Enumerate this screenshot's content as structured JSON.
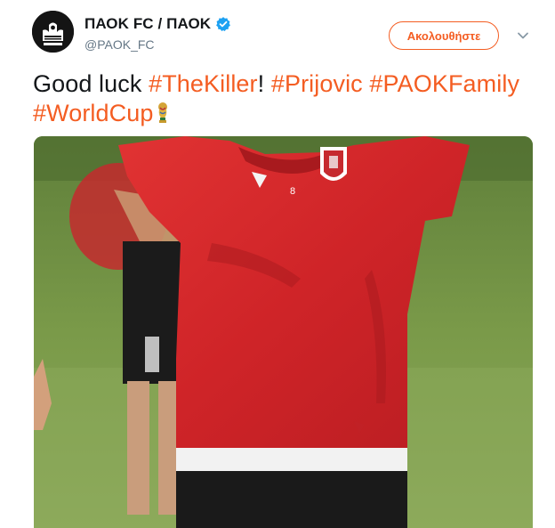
{
  "header": {
    "display_name": "ΠΑΟΚ FC / ΠΑΟΚ",
    "handle": "@PAOK_FC",
    "follow_label": "Ακολουθήστε",
    "avatar_icon": "paok-eagle-logo-icon",
    "verified_icon": "verified-badge-icon",
    "caret_icon": "chevron-down-icon"
  },
  "tweet": {
    "text_plain": "Good luck",
    "tag_1": "#TheKiller",
    "sep_1": "!",
    "tag_2": "#Prijovic",
    "tag_3": "#PAOKFamily",
    "tag_4": "#WorldCup",
    "emoji_icon": "world-cup-trophy-icon"
  },
  "media": {
    "type": "photo",
    "jersey_number": "8",
    "photo_icon": "football-player-photo"
  },
  "colors": {
    "accent": "#f45d22",
    "verified": "#1da1f2",
    "text": "#14171a",
    "muted": "#657786",
    "jersey_red": "#d8262a"
  }
}
